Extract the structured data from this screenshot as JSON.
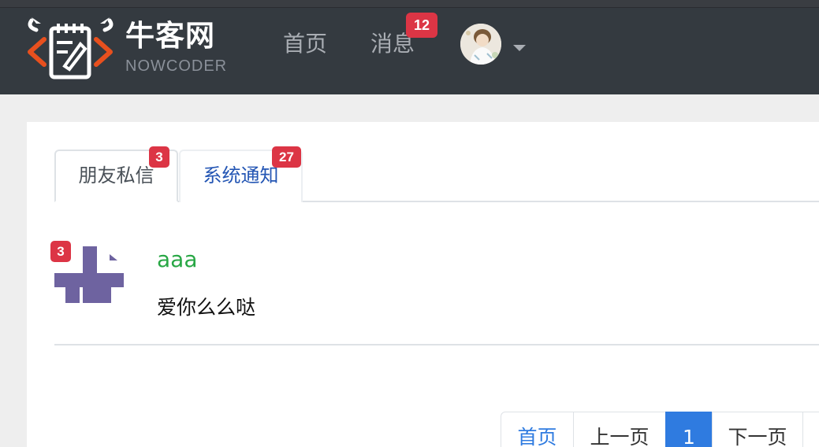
{
  "navbar": {
    "brand_cn": "牛客网",
    "brand_en": "NOWCODER",
    "links": [
      {
        "label": "首页"
      },
      {
        "label": "消息",
        "badge": "12"
      }
    ]
  },
  "tabs": [
    {
      "label": "朋友私信",
      "badge": "3",
      "active": true
    },
    {
      "label": "系统通知",
      "badge": "27",
      "active": false
    }
  ],
  "messages": [
    {
      "badge": "3",
      "username": "aaa",
      "text": "爱你么么哒"
    }
  ],
  "pagination": {
    "first": "首页",
    "prev": "上一页",
    "current": "1",
    "next": "下一页"
  },
  "colors": {
    "navbar": "#343a40",
    "badge": "#dc3545",
    "username": "#28a745",
    "link": "#2456b4",
    "page_active": "#2f7be0",
    "avatar_identicon": "#6e63a0"
  }
}
